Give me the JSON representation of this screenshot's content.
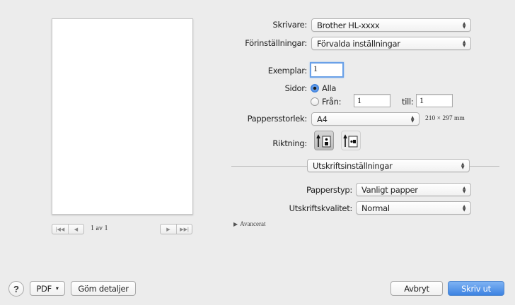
{
  "printer": {
    "label": "Skrivare:",
    "value": "Brother HL-xxxx"
  },
  "presets": {
    "label": "Förinställningar:",
    "value": "Förvalda inställningar"
  },
  "copies": {
    "label": "Exemplar:",
    "value": "1"
  },
  "pages": {
    "label": "Sidor:",
    "all_label": "Alla",
    "from_label": "Från:",
    "from_value": "1",
    "to_label": "till:",
    "to_value": "1",
    "selected": "all"
  },
  "paper_size": {
    "label": "Pappersstorlek:",
    "value": "A4",
    "dimensions": "210 × 297 mm"
  },
  "orientation": {
    "label": "Riktning:",
    "selected": "portrait"
  },
  "section_popup": {
    "value": "Utskriftsinställningar"
  },
  "paper_type": {
    "label": "Papperstyp:",
    "value": "Vanligt papper"
  },
  "print_quality": {
    "label": "Utskriftskvalitet:",
    "value": "Normal"
  },
  "advanced": {
    "label": "Avancerat"
  },
  "preview": {
    "page_count": "1 av 1",
    "first": "|◀◀",
    "prev": "◀",
    "next": "▶",
    "last": "▶▶|"
  },
  "footer": {
    "help": "?",
    "pdf_label": "PDF",
    "pdf_arrow": "▾",
    "hide_details": "Göm detaljer",
    "cancel": "Avbryt",
    "print": "Skriv ut"
  },
  "colors": {
    "accent": "#3d83e2",
    "background": "#ececec"
  }
}
